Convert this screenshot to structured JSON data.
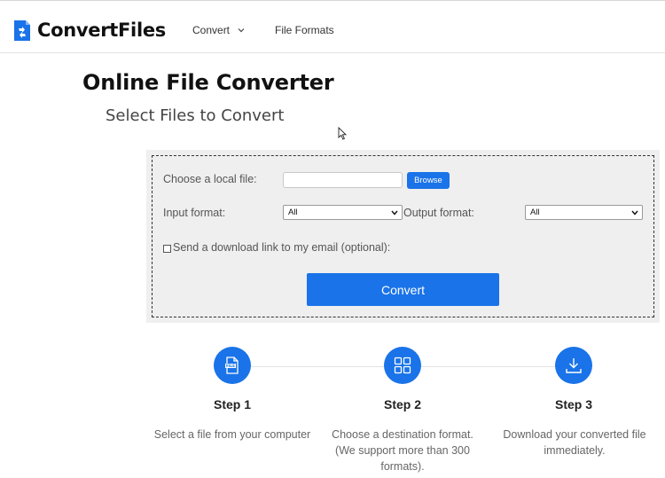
{
  "header": {
    "logo_text": "ConvertFiles",
    "nav": {
      "convert_label": "Convert",
      "file_formats_label": "File Formats"
    }
  },
  "main": {
    "title": "Online File Converter",
    "subtitle": "Select Files to Convert"
  },
  "form": {
    "local_file_label": "Choose a local file:",
    "file_value": "",
    "browse_label": "Browse",
    "input_format_label": "Input format:",
    "input_format_value": "All",
    "output_format_label": "Output format:",
    "output_format_value": "All",
    "email_checked": false,
    "email_label": "Send a download link to my email (optional):",
    "convert_label": "Convert"
  },
  "steps": [
    {
      "title": "Step 1",
      "description": "Select a file from your computer",
      "icon": "file-icon"
    },
    {
      "title": "Step 2",
      "description": "Choose a destination format. (We support more than 300 formats).",
      "icon": "grid-icon"
    },
    {
      "title": "Step 3",
      "description": "Download your converted file immediately.",
      "icon": "download-icon"
    }
  ],
  "colors": {
    "accent": "#1a73e8",
    "panel_bg": "#efefef",
    "text_dark": "#111111",
    "text_muted": "#666666"
  }
}
